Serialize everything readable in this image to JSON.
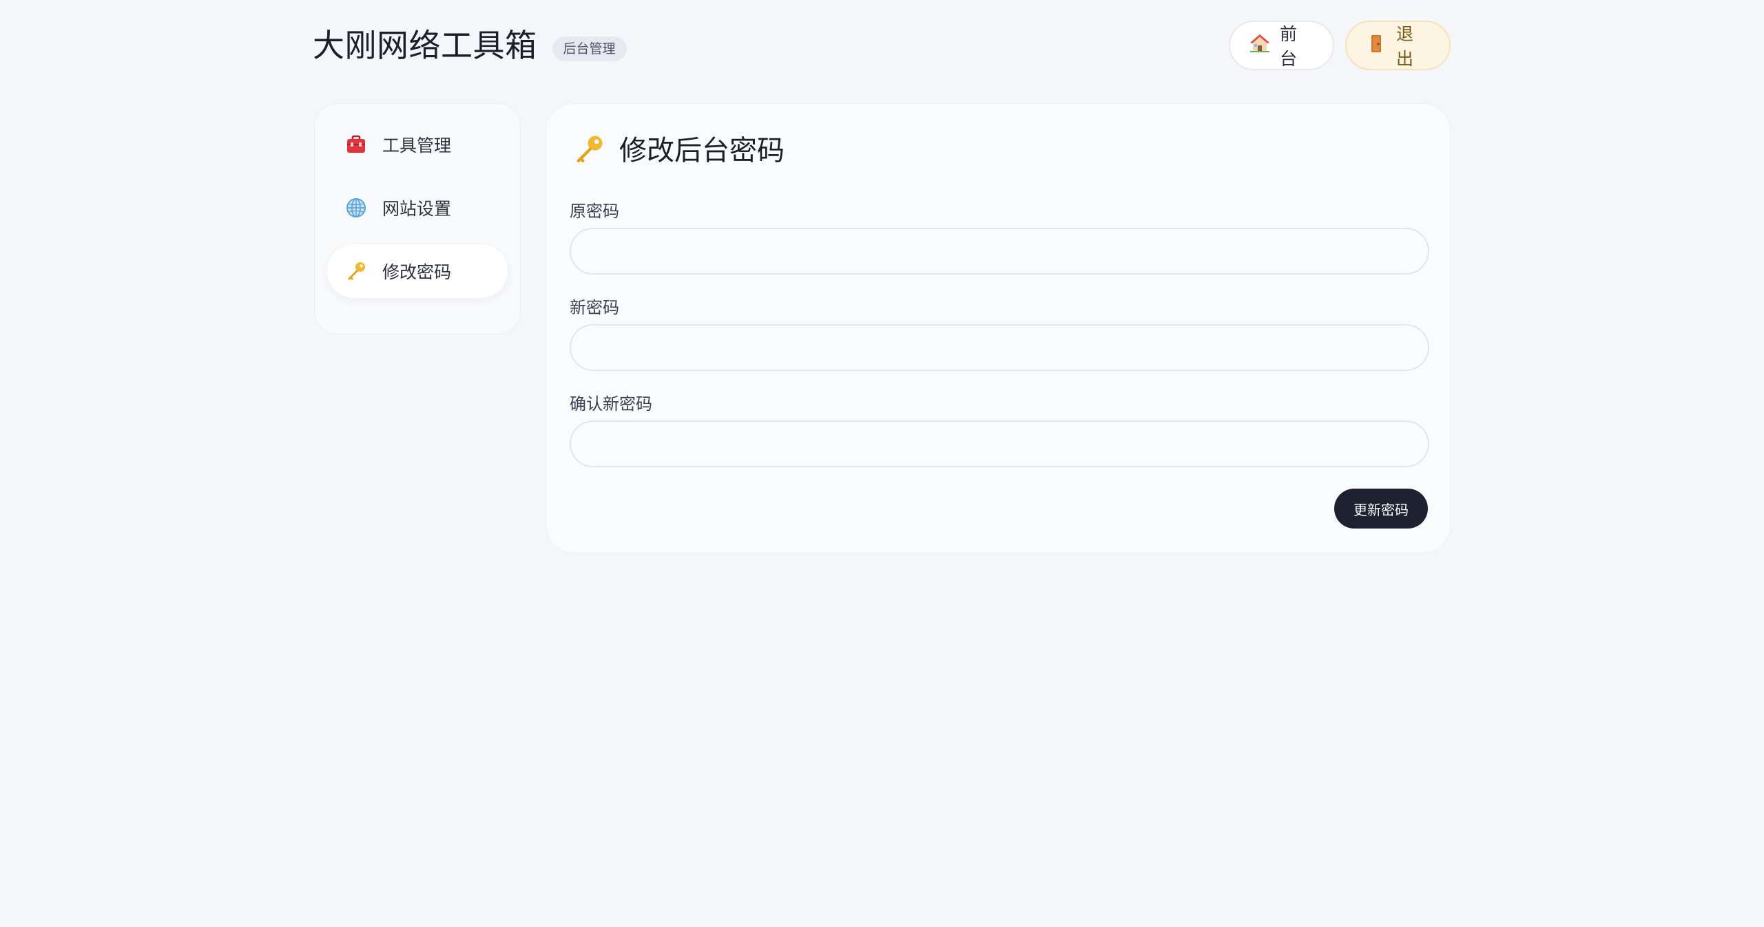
{
  "header": {
    "title": "大刚网络工具箱",
    "badge": "后台管理",
    "front_label": "前台",
    "exit_label": "退出"
  },
  "sidebar": {
    "items": [
      {
        "icon": "toolbox-icon",
        "label": "工具管理",
        "active": false
      },
      {
        "icon": "globe-icon",
        "label": "网站设置",
        "active": false
      },
      {
        "icon": "key-icon",
        "label": "修改密码",
        "active": true
      }
    ]
  },
  "main": {
    "title": "修改后台密码",
    "fields": [
      {
        "label": "原密码",
        "value": "",
        "placeholder": ""
      },
      {
        "label": "新密码",
        "value": "",
        "placeholder": ""
      },
      {
        "label": "确认新密码",
        "value": "",
        "placeholder": ""
      }
    ],
    "submit_label": "更新密码"
  },
  "colors": {
    "background": "#f5f6f9",
    "submit_button": "#1e2130",
    "exit_button_bg": "#fdf4e1",
    "key_icon": "#f2b731",
    "toolbox_icon": "#e0343f"
  }
}
